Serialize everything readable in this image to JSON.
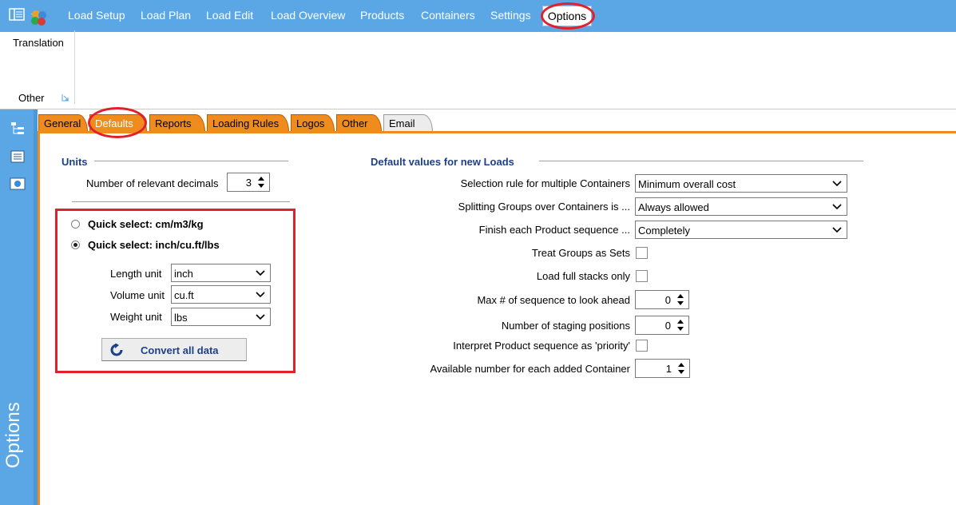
{
  "menu": {
    "items": [
      "Load Setup",
      "Load Plan",
      "Load Edit",
      "Load Overview",
      "Products",
      "Containers",
      "Settings"
    ],
    "active": "Options"
  },
  "ribbon": {
    "translation_label": "Translation",
    "group_label": "Other"
  },
  "side_title": "Options",
  "tabs": [
    "General",
    "Defaults",
    "Reports",
    "Loading Rules",
    "Logos",
    "Other",
    "Email"
  ],
  "units": {
    "title": "Units",
    "decimals_label": "Number of relevant decimals",
    "decimals_value": "3",
    "quick_select_metric": "Quick select: cm/m3/kg",
    "quick_select_imperial": "Quick select: inch/cu.ft/lbs",
    "length_label": "Length unit",
    "length_value": "inch",
    "volume_label": "Volume unit",
    "volume_value": "cu.ft",
    "weight_label": "Weight unit",
    "weight_value": "lbs",
    "convert_label": "Convert all data"
  },
  "defaults": {
    "title": "Default values for new Loads",
    "selection_rule_label": "Selection rule for multiple Containers",
    "selection_rule_value": "Minimum overall cost",
    "splitting_label": "Splitting Groups over Containers is ...",
    "splitting_value": "Always allowed",
    "finish_label": "Finish each Product sequence ...",
    "finish_value": "Completely",
    "treat_groups_label": "Treat Groups as Sets",
    "full_stacks_label": "Load full stacks only",
    "lookahead_label": "Max # of sequence to look ahead",
    "lookahead_value": "0",
    "staging_label": "Number of staging positions",
    "staging_value": "0",
    "priority_label": "Interpret Product sequence as 'priority'",
    "available_label": "Available number for each added Container",
    "available_value": "1"
  },
  "colors": {
    "menubar": "#5ba7e6",
    "tab_orange": "#f08c1e",
    "heading_blue": "#1f3f8a",
    "highlight_red": "#e0202a"
  }
}
